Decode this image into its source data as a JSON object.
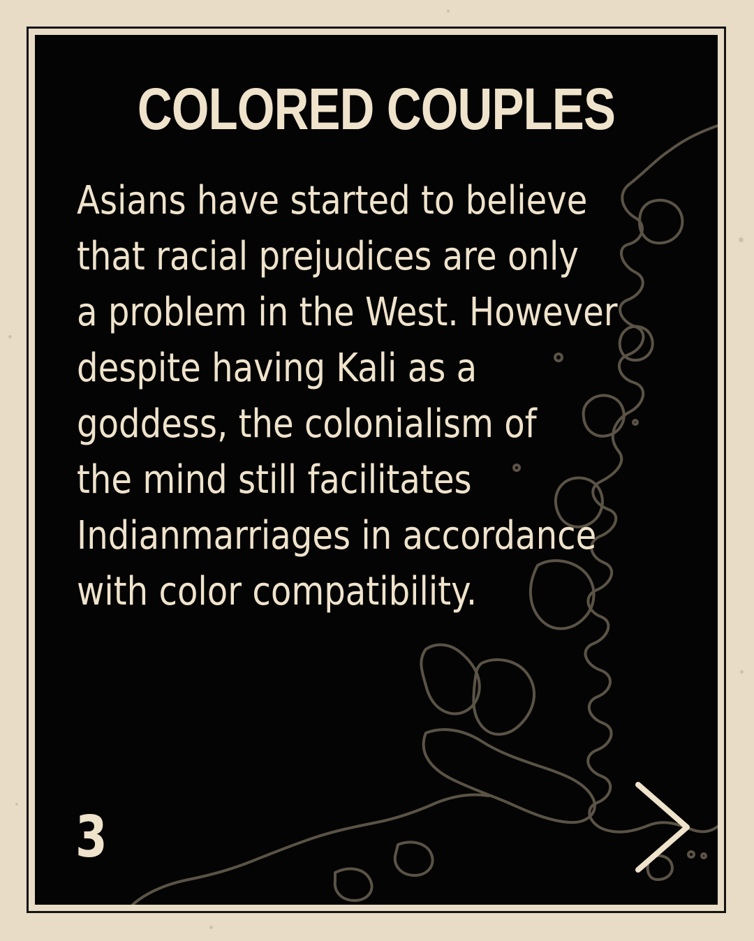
{
  "card": {
    "title": "COLORED COUPLES",
    "body_lines": [
      "Asians have started to believe",
      "that racial prejudices are only",
      "a problem in the West. However",
      "despite having Kali as a",
      "goddess, the colonialism of",
      "the mind still facilitates",
      "Indianmarriages in accordance",
      "with color compatibility."
    ],
    "page_number": "3",
    "next_icon": "chevron-right-icon"
  },
  "colors": {
    "paper": "#e8dcc6",
    "card_background": "#040404",
    "text": "#efe3cc",
    "map_lines": "#5a5346"
  }
}
